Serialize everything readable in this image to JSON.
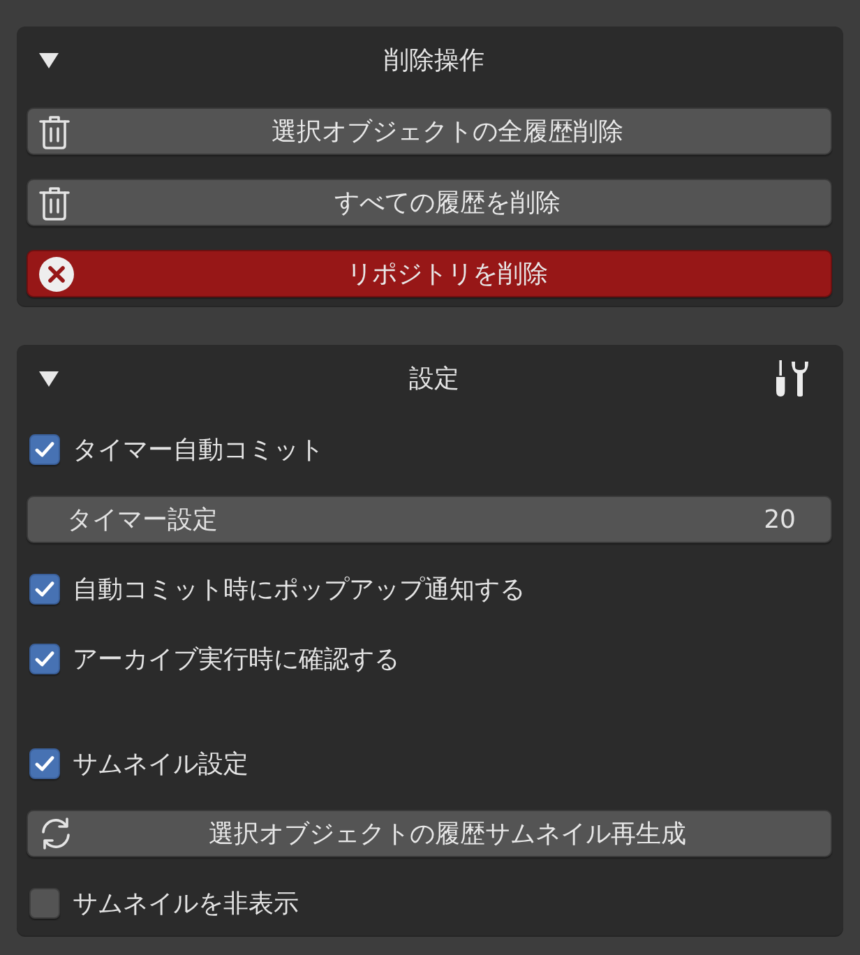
{
  "panels": [
    {
      "kind": "plain",
      "title": "削除操作",
      "expanded": true,
      "items": [
        {
          "kind": "delete",
          "label": "選択オブジェクトの全履歴削除"
        },
        {
          "kind": "delete",
          "label": "すべての履歴を削除"
        },
        {
          "kind": "destroy",
          "label": "リポジトリを削除"
        }
      ]
    },
    {
      "kind": "tools",
      "title": "設定",
      "expanded": true,
      "items": [
        {
          "kind": "checkbox",
          "label": "タイマー自動コミット",
          "checked": true
        },
        {
          "kind": "number",
          "label": "タイマー設定",
          "value": "20"
        },
        {
          "kind": "checkbox",
          "label": "自動コミット時にポップアップ通知する",
          "checked": true
        },
        {
          "kind": "checkbox",
          "label": "アーカイブ実行時に確認する",
          "checked": true
        },
        {
          "kind": "spacer"
        },
        {
          "kind": "checkbox",
          "label": "サムネイル設定",
          "checked": true
        },
        {
          "kind": "regenerate",
          "label": "選択オブジェクトの履歴サムネイル再生成"
        },
        {
          "kind": "checkbox",
          "label": "サムネイルを非表示",
          "checked": false
        }
      ]
    }
  ]
}
